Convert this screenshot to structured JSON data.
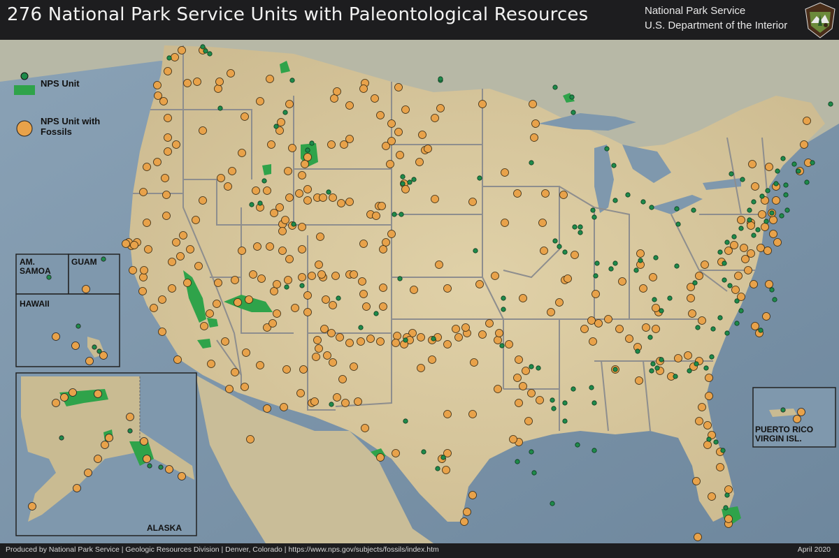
{
  "header": {
    "title": "276 National Park Service Units with Paleontological Resources",
    "org_line1": "National Park Service",
    "org_line2": "U.S. Department of the Interior"
  },
  "legend": {
    "nps_unit": "NPS Unit",
    "fossil_line1": "NPS Unit with",
    "fossil_line2": "Fossils"
  },
  "insets": {
    "samoa_1": "AM.",
    "samoa_2": "SAMOA",
    "guam": "GUAM",
    "hawaii": "HAWAII",
    "alaska": "ALASKA",
    "pr_1": "PUERTO RICO",
    "pr_2": "VIRGIN ISL."
  },
  "colors": {
    "fossil": "#e8a24a",
    "unit": "#1e8a4a",
    "unit_area": "#2fa34a",
    "land": "#d9c9a0",
    "water": "#7f98ad",
    "border": "#8d8d8d"
  },
  "footer": {
    "credit": "Produced by National Park Service  |  Geologic Resources Division  |  Denver, Colorado  |  https://www.nps.gov/subjects/fossils/index.htm",
    "date": "April 2020"
  }
}
